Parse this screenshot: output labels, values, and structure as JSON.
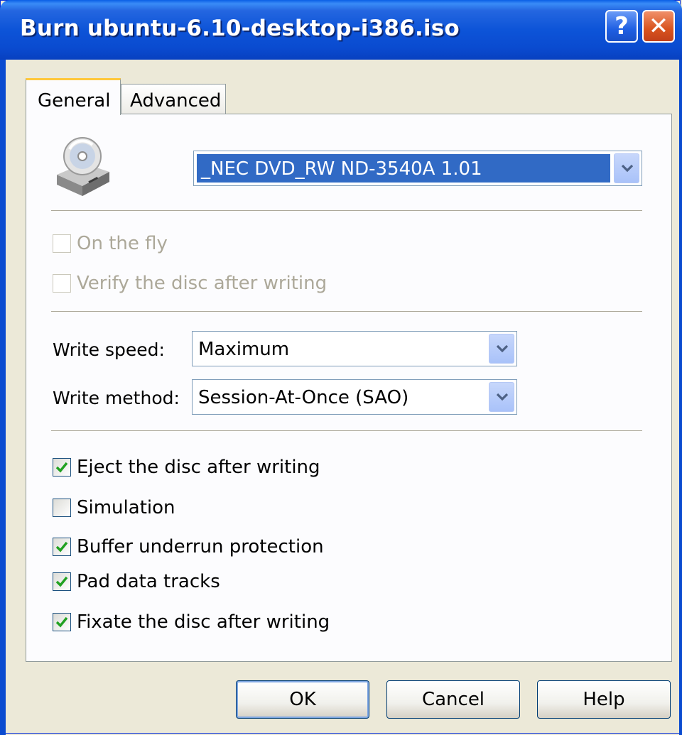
{
  "window": {
    "title": "Burn ubuntu-6.10-desktop-i386.iso",
    "help_glyph": "?",
    "close_glyph": "✕"
  },
  "tabs": [
    {
      "label": "General",
      "active": true
    },
    {
      "label": "Advanced",
      "active": false
    }
  ],
  "drive": {
    "icon": "optical-drive-icon",
    "selected": "_NEC DVD_RW ND-3540A 1.01"
  },
  "disabled_options": [
    {
      "label": "On the fly",
      "checked": false
    },
    {
      "label": "Verify the disc after writing",
      "checked": false
    }
  ],
  "write_speed": {
    "label": "Write speed:",
    "value": "Maximum"
  },
  "write_method": {
    "label": "Write method:",
    "value": "Session-At-Once (SAO)"
  },
  "options": [
    {
      "label": "Eject the disc after writing",
      "checked": true
    },
    {
      "label": "Simulation",
      "checked": false
    },
    {
      "label": "Buffer underrun protection",
      "checked": true
    },
    {
      "label": "Pad data tracks",
      "checked": true
    },
    {
      "label": "Fixate the disc after writing",
      "checked": true
    }
  ],
  "buttons": {
    "ok": "OK",
    "cancel": "Cancel",
    "help": "Help"
  },
  "colors": {
    "title_bar": "#0A4BD0",
    "selection": "#316AC5",
    "check_green": "#21A121",
    "face": "#ECE9D8"
  }
}
